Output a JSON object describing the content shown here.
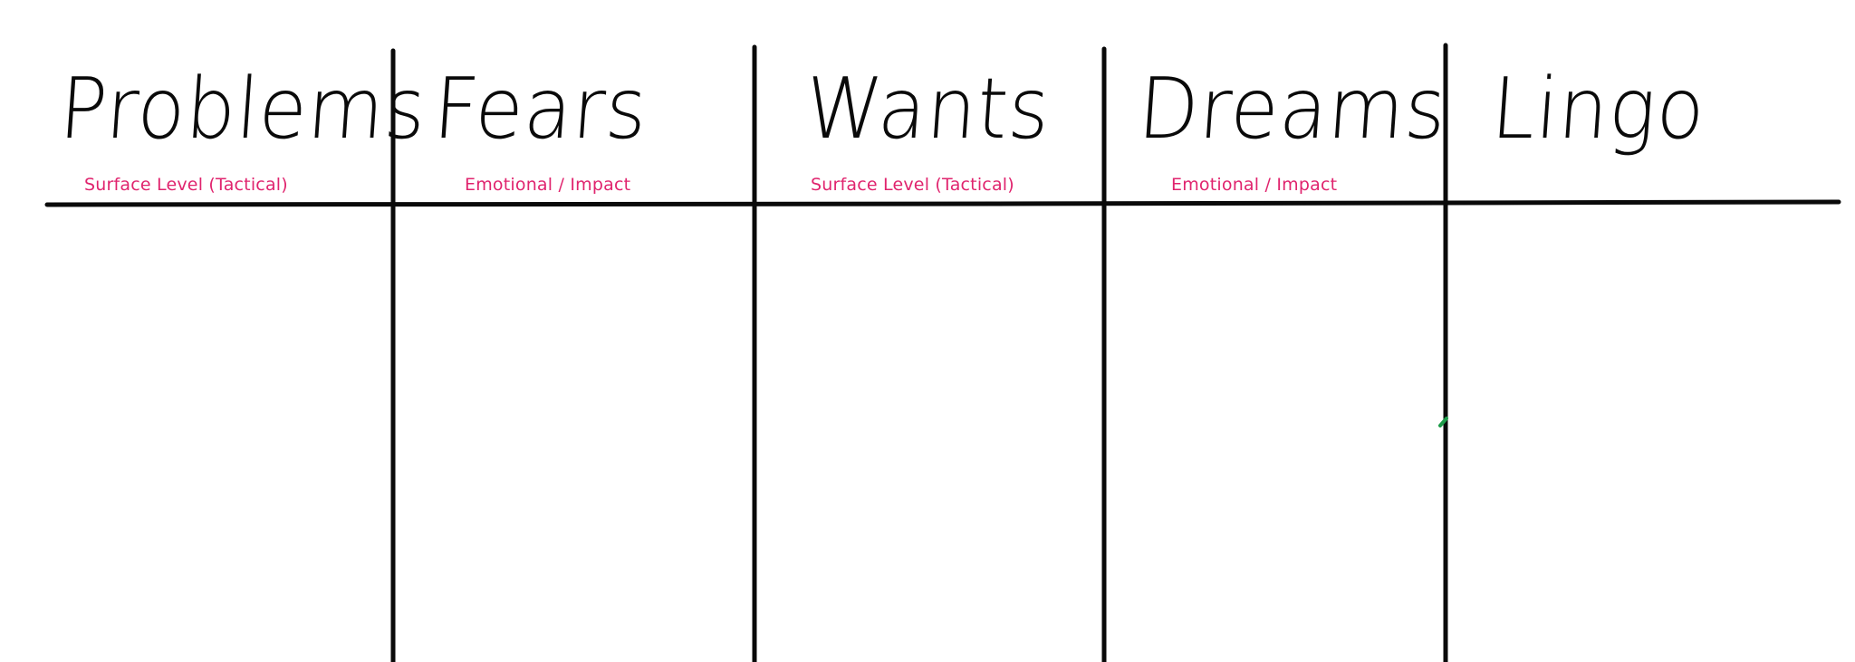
{
  "board": {
    "columns": [
      {
        "heading": "Problems",
        "subheading": "Surface Level (Tactical)"
      },
      {
        "heading": "Fears",
        "subheading": "Emotional / Impact"
      },
      {
        "heading": "Wants",
        "subheading": "Surface Level (Tactical)"
      },
      {
        "heading": "Dreams",
        "subheading": "Emotional / Impact"
      },
      {
        "heading": "Lingo",
        "subheading": ""
      }
    ]
  },
  "colors": {
    "ink": "#0a0a0a",
    "subheading": "#e0246e",
    "stray_mark": "#1e9c4a"
  }
}
